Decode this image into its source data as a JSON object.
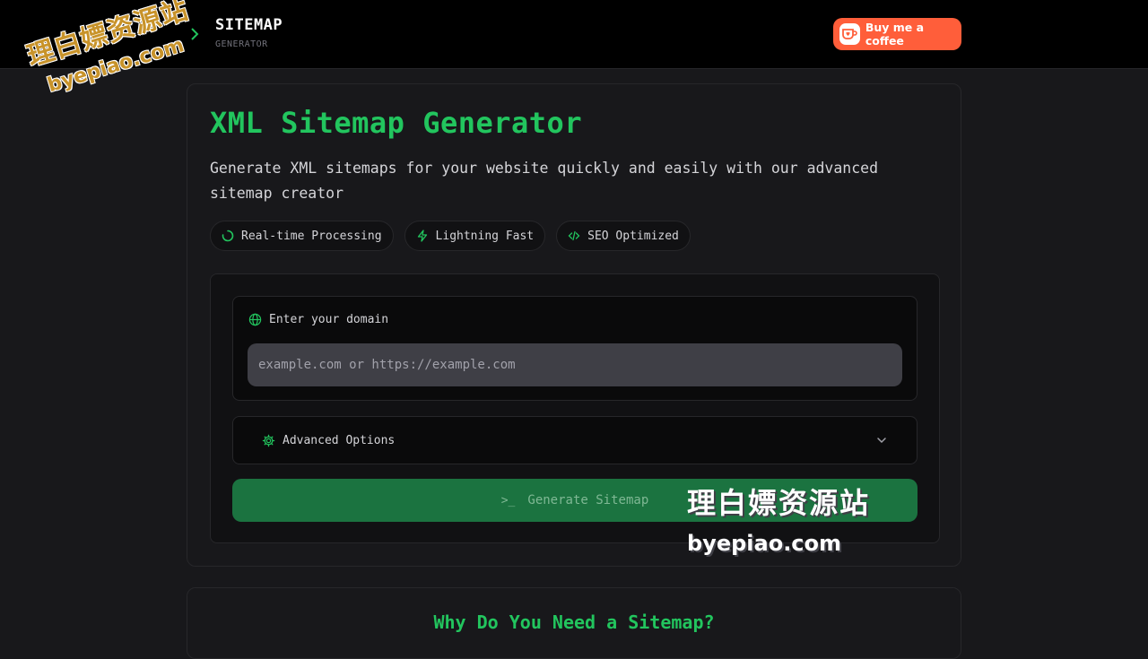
{
  "header": {
    "brand_title": "SITEMAP",
    "brand_subtitle": "GENERATOR",
    "coffee_label": "Buy me a coffee"
  },
  "hero": {
    "title": "XML Sitemap Generator",
    "description": "Generate XML sitemaps for your website quickly and easily with our advanced sitemap creator",
    "chips": [
      {
        "label": "Real-time Processing",
        "icon": "loader-icon"
      },
      {
        "label": "Lightning Fast",
        "icon": "lightning-icon"
      },
      {
        "label": "SEO Optimized",
        "icon": "code-icon"
      }
    ]
  },
  "form": {
    "domain_label": "Enter your domain",
    "domain_placeholder": "example.com or https://example.com",
    "domain_value": "",
    "advanced_label": "Advanced Options",
    "generate_prompt": ">_",
    "generate_label": "Generate Sitemap"
  },
  "section2": {
    "title": "Why Do You Need a Sitemap?"
  },
  "watermarks": {
    "top_left_cn": "理白嫖资源站",
    "top_left_url": "byepiao.com",
    "bottom_right_cn": "理白嫖资源站",
    "bottom_right_url": "byepiao.com"
  },
  "colors": {
    "accent": "#22c55e",
    "coffee": "#ff5e3a",
    "generate_button": "#1b7340",
    "background": "#18181b"
  }
}
